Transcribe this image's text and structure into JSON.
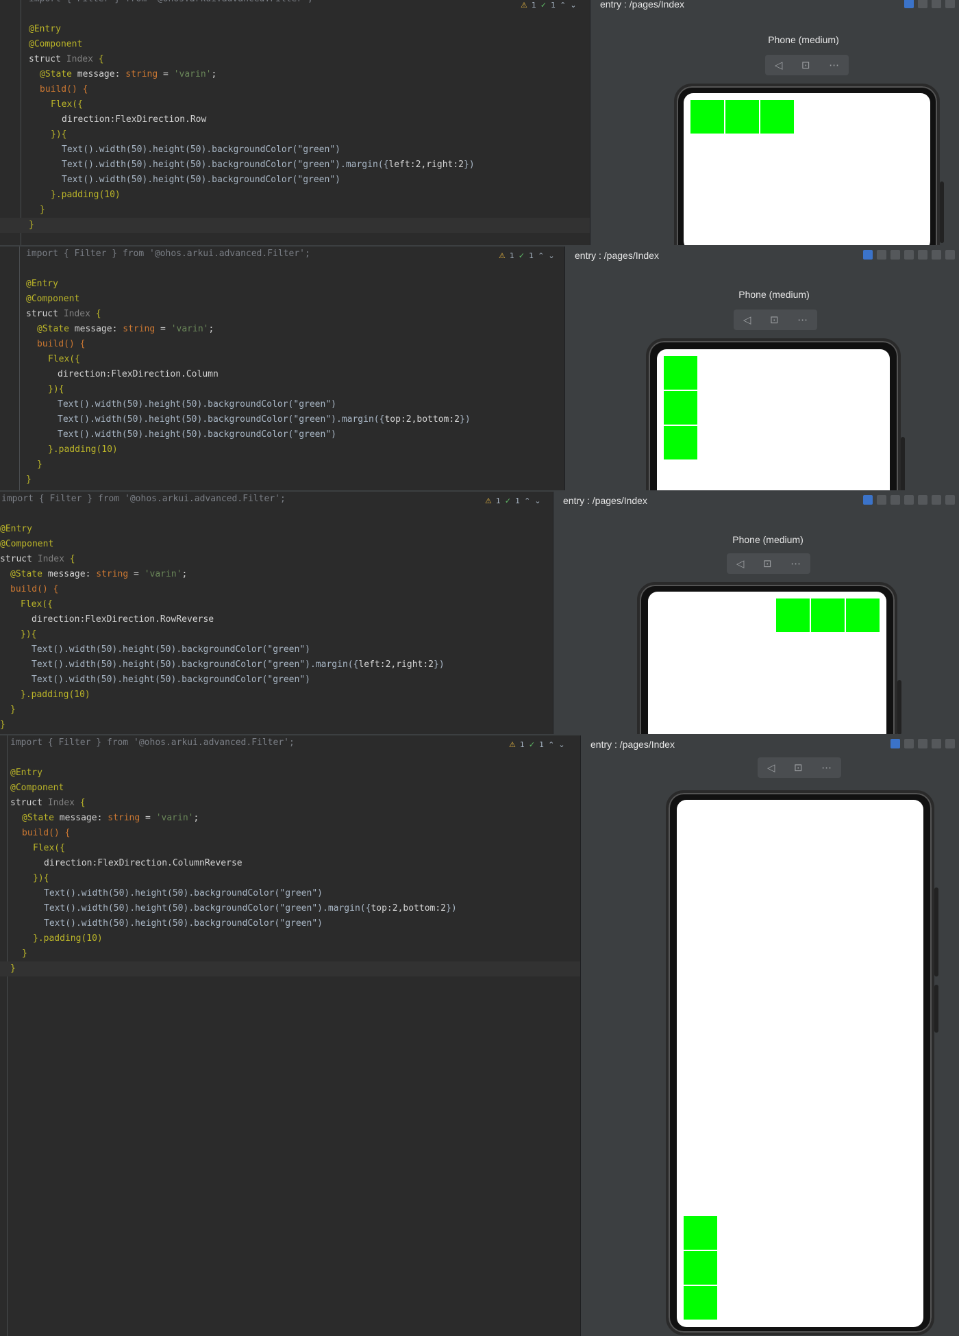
{
  "panels": [
    {
      "preview_title": "entry : /pages/Index",
      "device_name": "Phone (medium)",
      "direction": "FlexDirection.Row",
      "margin_text": "left:2,right:2",
      "problems": {
        "warnings": "1",
        "checks": "1"
      },
      "import_line": "import { Filter } from '@ohos.arkui.advanced.Filter';"
    },
    {
      "preview_title": "entry : /pages/Index",
      "device_name": "Phone (medium)",
      "direction": "FlexDirection.Column",
      "margin_text": "top:2,bottom:2",
      "problems": {
        "warnings": "1",
        "checks": "1"
      },
      "import_line": "import { Filter } from '@ohos.arkui.advanced.Filter';"
    },
    {
      "preview_title": "entry : /pages/Index",
      "device_name": "Phone (medium)",
      "direction": "FlexDirection.RowReverse",
      "margin_text": "left:2,right:2",
      "problems": {
        "warnings": "1",
        "checks": "1"
      },
      "import_line": "import { Filter } from '@ohos.arkui.advanced.Filter';"
    },
    {
      "preview_title": "entry : /pages/Index",
      "device_name": "",
      "direction": "FlexDirection.ColumnReverse",
      "margin_text": "top:2,bottom:2",
      "problems": {
        "warnings": "1",
        "checks": "1"
      },
      "import_line": "import { Filter } from '@ohos.arkui.advanced.Filter';"
    }
  ],
  "code": {
    "entry": "@Entry",
    "component": "@Component",
    "struct_kw": "struct",
    "struct_name": "Index",
    "state_line_a": "@State",
    "state_line_b": "message:",
    "state_line_c": "string",
    "state_line_d": "=",
    "state_value": "'varin'",
    "build": "build() {",
    "flex_open": "Flex({",
    "direction_key": "direction:",
    "flex_close": "}){",
    "text_line": "Text().width(50).height(50).backgroundColor(\"green\")",
    "text_margin_prefix": "Text().width(50).height(50).backgroundColor(\"green\").margin({",
    "text_margin_suffix": "})",
    "padding": "}.padding(10)",
    "close_inner": "}",
    "close_outer": "}"
  },
  "colors": {
    "box": "#00ff00",
    "preview_bg": "#3c3f41",
    "editor_bg": "#2b2b2b"
  }
}
